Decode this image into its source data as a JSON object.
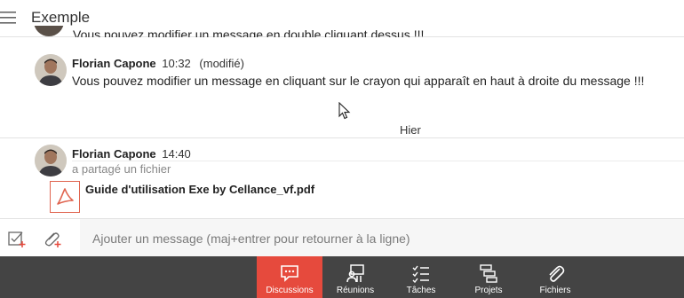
{
  "header": {
    "title": "Exemple"
  },
  "messages": [
    {
      "text": "Vous pouvez modifier un message en double cliquant dessus !!!"
    },
    {
      "author": "Florian Capone",
      "time": "10:32",
      "edited": "(modifié)",
      "text": "Vous pouvez modifier un message en cliquant sur le crayon qui apparaît en haut à droite du message !!!"
    }
  ],
  "day_separator": "Hier",
  "shared_message": {
    "author": "Florian Capone",
    "time": "14:40",
    "note": "a partagé un fichier",
    "file_name": "Guide d'utilisation Exe by Cellance_vf.pdf"
  },
  "composer": {
    "placeholder": "Ajouter un message (maj+entrer pour retourner à la ligne)"
  },
  "nav": [
    {
      "label": "Discussions",
      "icon": "chat-icon",
      "active": true
    },
    {
      "label": "Réunions",
      "icon": "meeting-icon",
      "active": false
    },
    {
      "label": "Tâches",
      "icon": "tasks-icon",
      "active": false
    },
    {
      "label": "Projets",
      "icon": "projects-icon",
      "active": false
    },
    {
      "label": "Fichiers",
      "icon": "paperclip-icon",
      "active": false
    }
  ],
  "colors": {
    "accent": "#e64a3d",
    "nav_bg": "#444444",
    "file_icon": "#e0644f"
  }
}
